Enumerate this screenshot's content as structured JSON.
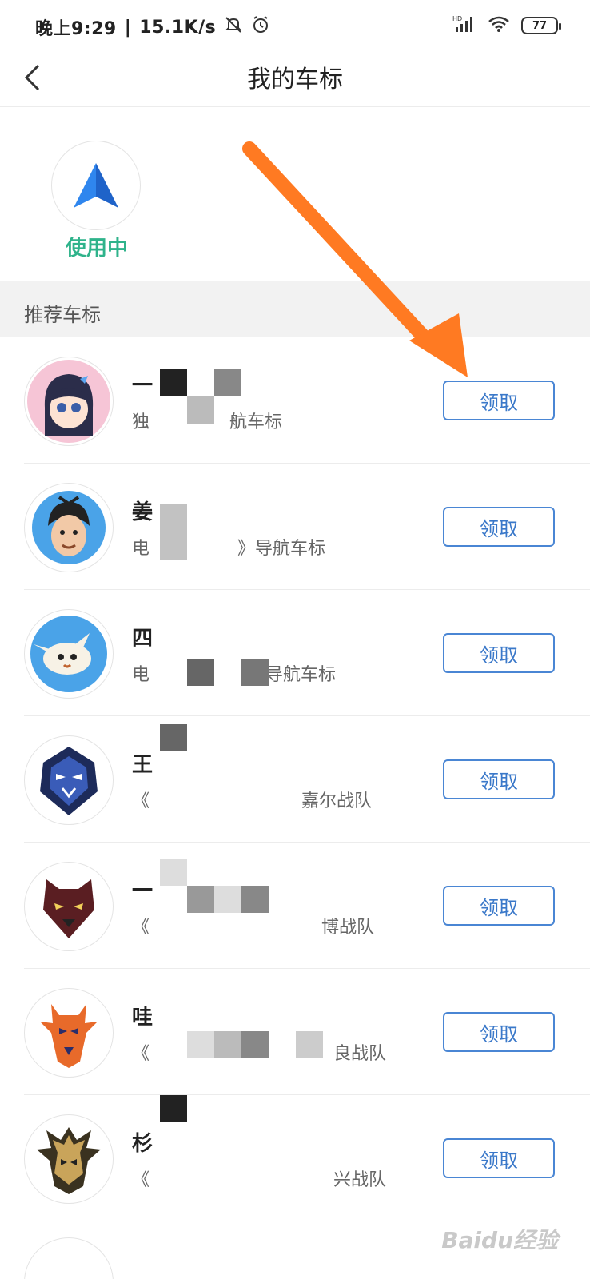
{
  "status_bar": {
    "time": "晚上9:29",
    "speed": "15.1K/s",
    "network": "HD",
    "battery": "77"
  },
  "nav": {
    "title": "我的车标"
  },
  "current": {
    "status_label": "使用中",
    "icon": "navigation-arrow-icon",
    "color": "#2fb38b"
  },
  "section": {
    "title": "推荐车标"
  },
  "items": [
    {
      "title": "一",
      "subtitle": "独",
      "subtitle_tail": "航车标",
      "button": "领取",
      "avatar": "anime-girl-avatar"
    },
    {
      "title": "姜",
      "subtitle": "电",
      "subtitle_tail": "》导航车标",
      "button": "领取",
      "avatar": "warrior-avatar"
    },
    {
      "title": "四",
      "subtitle": "电",
      "subtitle_tail": "导航车标",
      "button": "领取",
      "avatar": "rabbit-avatar"
    },
    {
      "title": "王",
      "subtitle": "《",
      "subtitle_tail": "嘉尔战队",
      "button": "领取",
      "avatar": "lion-mask-avatar"
    },
    {
      "title": "一",
      "subtitle": "《",
      "subtitle_tail": "博战队",
      "button": "领取",
      "avatar": "panther-avatar"
    },
    {
      "title": "哇",
      "subtitle": "《",
      "subtitle_tail": "良战队",
      "button": "领取",
      "avatar": "giraffe-avatar"
    },
    {
      "title": "杉",
      "subtitle": "《",
      "subtitle_tail": "兴战队",
      "button": "领取",
      "avatar": "dragon-avatar"
    }
  ],
  "watermark": "Baidu经验",
  "colors": {
    "accent_blue": "#3a78c9",
    "status_green": "#2fb38b",
    "annotation_orange": "#ff7a22"
  }
}
